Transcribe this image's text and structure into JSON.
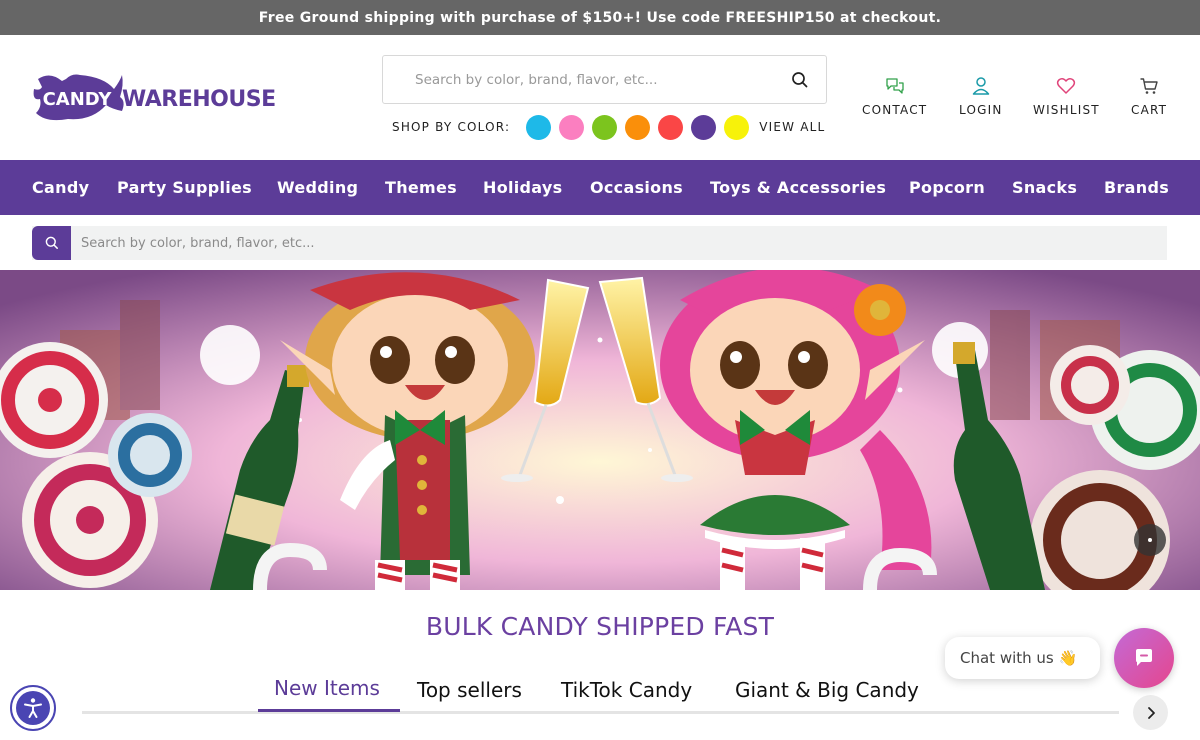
{
  "promo": {
    "text": "Free Ground shipping with purchase of $150+! Use code FREESHIP150 at checkout."
  },
  "logo": {
    "word1": "CANDY",
    "word2": "WAREHOUSE"
  },
  "search": {
    "placeholder": "Search by color, brand, flavor, etc..."
  },
  "shop_by_color": {
    "label": "SHOP BY COLOR:",
    "swatches": [
      {
        "name": "blue",
        "color": "#1eb9e8"
      },
      {
        "name": "pink",
        "color": "#fb7fc0"
      },
      {
        "name": "green",
        "color": "#7cc41e"
      },
      {
        "name": "orange",
        "color": "#fa8f0a"
      },
      {
        "name": "red",
        "color": "#fa4646"
      },
      {
        "name": "purple",
        "color": "#5c3c98"
      },
      {
        "name": "yellow",
        "color": "#f7f20a"
      }
    ],
    "view_all": "VIEW ALL"
  },
  "utility": {
    "contact": "CONTACT",
    "login": "LOGIN",
    "wishlist": "WISHLIST",
    "cart": "CART"
  },
  "nav": {
    "items": [
      "Candy",
      "Party Supplies",
      "Wedding",
      "Themes",
      "Holidays",
      "Occasions",
      "Toys & Accessories",
      "Popcorn",
      "Snacks",
      "Brands"
    ]
  },
  "sub_search": {
    "placeholder": "Search by color, brand, flavor, etc..."
  },
  "section": {
    "title": "BULK CANDY SHIPPED FAST"
  },
  "tabs": {
    "items": [
      "New Items",
      "Top sellers",
      "TikTok Candy",
      "Giant & Big Candy"
    ],
    "active_index": 0
  },
  "chat": {
    "label": "Chat with us 👋"
  },
  "colors": {
    "brand_purple": "#5c3c98",
    "title_purple": "#6b40a1",
    "promo_gray": "#666666",
    "wishlist_pink": "#e0447a",
    "icon_teal": "#1a9aa8",
    "contact_green": "#31a14a"
  }
}
